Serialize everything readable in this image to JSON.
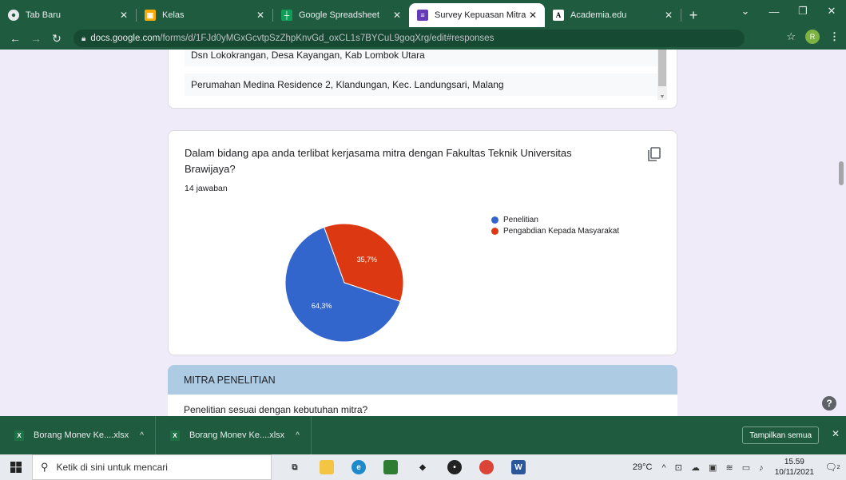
{
  "browser": {
    "tabs": [
      {
        "title": "Tab Baru",
        "icon": "chrome-icon",
        "color": "#ffffff"
      },
      {
        "title": "Kelas",
        "icon": "classroom-icon",
        "color": "#f9ab00"
      },
      {
        "title": "Google Spreadsheet",
        "icon": "sheets-icon",
        "color": "#0f9d58"
      },
      {
        "title": "Survey Kepuasan Mitra - (",
        "icon": "forms-icon",
        "color": "#673ab7"
      },
      {
        "title": "Academia.edu",
        "icon": "academia-icon",
        "color": "#ffffff"
      }
    ],
    "url_host": "docs.google.com",
    "url_path": "/forms/d/1FJd0yMGxGcvtpSzZhpKnvGd_oxCL1s7BYCuL9goqXrg/edit#responses",
    "avatar_letter": "R"
  },
  "form": {
    "addresses": [
      "Dsn Lokokrangan, Desa Kayangan, Kab Lombok Utara",
      "Perumahan Medina Residence 2, Klandungan, Kec. Landungsari, Malang"
    ],
    "question": "Dalam bidang apa anda terlibat kerjasama mitra dengan Fakultas Teknik Universitas Brawijaya?",
    "response_count": "14 jawaban",
    "section_title": "MITRA PENELITIAN",
    "next_question": "Penelitian sesuai dengan kebutuhan mitra?"
  },
  "chart_data": {
    "type": "pie",
    "slices": [
      {
        "label": "Penelitian",
        "value": 64.3,
        "display": "64,3%",
        "color": "#3366cc"
      },
      {
        "label": "Pengabdian Kepada Masyarakat",
        "value": 35.7,
        "display": "35,7%",
        "color": "#dc3912"
      }
    ]
  },
  "downloads": {
    "items": [
      "Borang Monev Ke....xlsx",
      "Borang Monev Ke....xlsx"
    ],
    "show_all": "Tampilkan semua"
  },
  "taskbar": {
    "search_placeholder": "Ketik di sini untuk mencari",
    "temperature": "29°C",
    "time": "15.59",
    "date": "10/11/2021",
    "notification_count": "2"
  }
}
